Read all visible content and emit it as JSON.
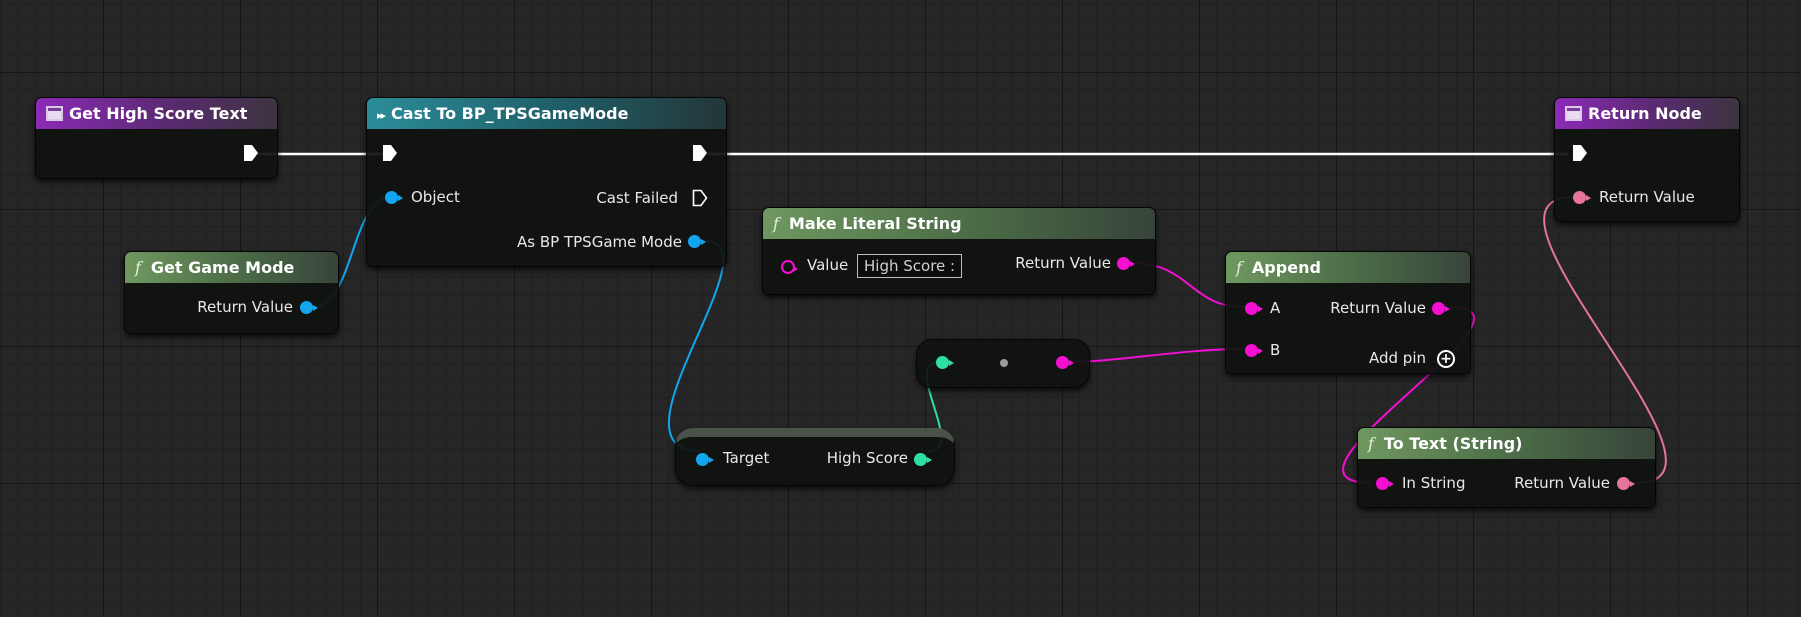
{
  "nodes": {
    "get_high_score_text": {
      "title": "Get High Score Text"
    },
    "cast": {
      "title": "Cast To BP_TPSGameMode",
      "object": "Object",
      "cast_failed": "Cast Failed",
      "as_game_mode": "As BP TPSGame Mode"
    },
    "get_game_mode": {
      "title": "Get Game Mode",
      "return_value": "Return Value"
    },
    "make_literal_string": {
      "title": "Make Literal String",
      "value_label": "Value",
      "value": "High Score :",
      "return_value": "Return Value"
    },
    "append": {
      "title": "Append",
      "a": "A",
      "b": "B",
      "return_value": "Return Value",
      "add_pin": "Add pin"
    },
    "return_node": {
      "title": "Return Node",
      "return_value": "Return Value"
    },
    "get_high_score": {
      "target": "Target",
      "high_score": "High Score"
    },
    "to_text_string": {
      "title": "To Text (String)",
      "in_string": "In String",
      "return_value": "Return Value"
    }
  },
  "colors": {
    "object_pin": "#12a6f0",
    "string_pin": "#f40fd3",
    "text_pin": "#e5759a",
    "int_pin": "#2edfa4",
    "exec_wire": "#ffffff"
  }
}
